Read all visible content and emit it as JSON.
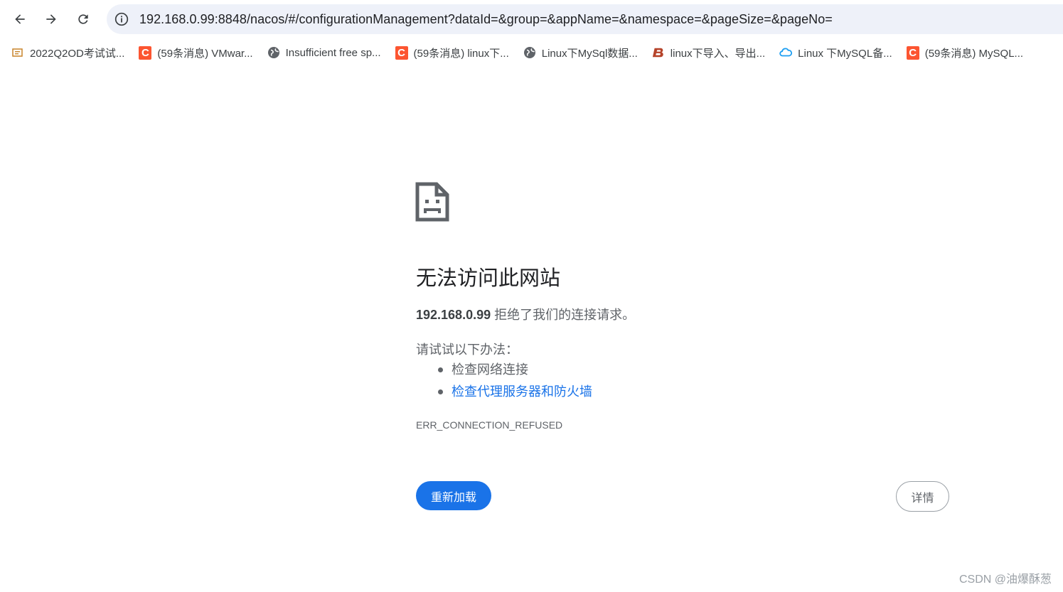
{
  "toolbar": {
    "back_icon": "arrow-left-icon",
    "forward_icon": "arrow-right-icon",
    "reload_icon": "reload-icon",
    "site_info_icon": "info-icon",
    "url": "192.168.0.99:8848/nacos/#/configurationManagement?dataId=&group=&appName=&namespace=&pageSize=&pageNo="
  },
  "bookmarks": [
    {
      "icon": "doc-favicon",
      "label": "2022Q2OD考试试..."
    },
    {
      "icon": "csdn-favicon",
      "label": "(59条消息) VMwar..."
    },
    {
      "icon": "globe-icon",
      "label": "Insufficient free sp..."
    },
    {
      "icon": "csdn-favicon",
      "label": "(59条消息) linux下..."
    },
    {
      "icon": "globe-icon",
      "label": "Linux下MySql数据..."
    },
    {
      "icon": "b-favicon",
      "label": "linux下导入、导出..."
    },
    {
      "icon": "cloud-favicon",
      "label": "Linux 下MySQL备..."
    },
    {
      "icon": "csdn-favicon",
      "label": "(59条消息) MySQL..."
    }
  ],
  "error": {
    "icon": "sad-document-icon",
    "title": "无法访问此网站",
    "host": "192.168.0.99",
    "description_suffix": " 拒绝了我们的连接请求。",
    "try_label": "请试试以下办法：",
    "suggestions": [
      {
        "text": "检查网络连接",
        "is_link": false
      },
      {
        "text": "检查代理服务器和防火墙",
        "is_link": true
      }
    ],
    "code": "ERR_CONNECTION_REFUSED",
    "reload_label": "重新加载",
    "details_label": "详情"
  },
  "watermark": "CSDN @油爆酥葱",
  "colors": {
    "primary_blue": "#1a73e8",
    "omnibox_bg": "#eef1f9",
    "text_secondary": "#5f6368",
    "csdn_red": "#fc5531"
  }
}
